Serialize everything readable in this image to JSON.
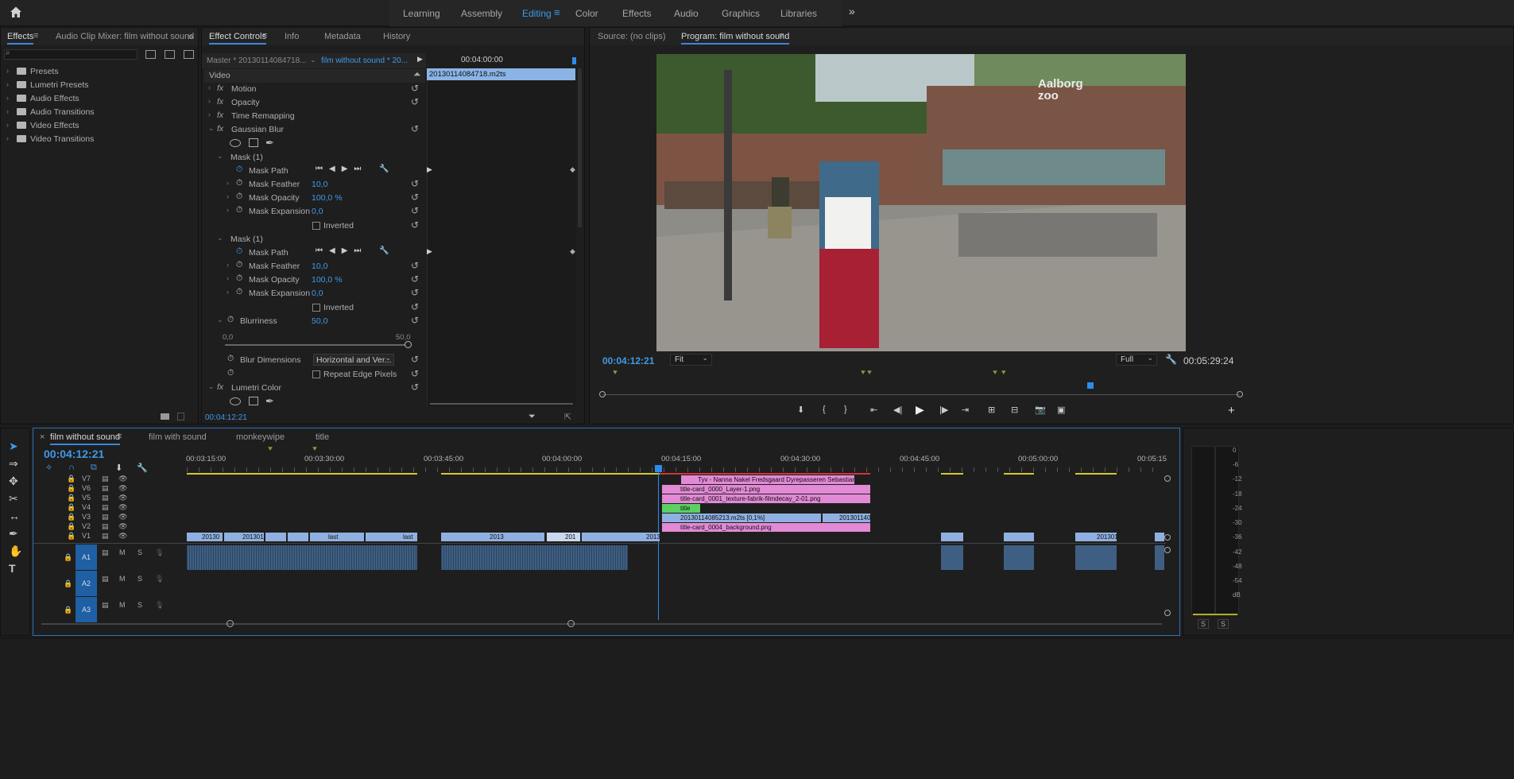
{
  "workspaces": {
    "tabs": [
      "Learning",
      "Assembly",
      "Editing",
      "Color",
      "Effects",
      "Audio",
      "Graphics",
      "Libraries"
    ],
    "active": "Editing"
  },
  "effects_panel": {
    "tabs": [
      "Effects",
      "Audio Clip Mixer: film without sound"
    ],
    "folders": [
      "Presets",
      "Lumetri Presets",
      "Audio Effects",
      "Audio Transitions",
      "Video Effects",
      "Video Transitions"
    ]
  },
  "effect_controls": {
    "tabs": [
      "Effect Controls",
      "Info",
      "Metadata",
      "History"
    ],
    "master": "Master * 20130114084718...",
    "sequence": "film without sound * 20...",
    "timecode_head": "00:04:00:00",
    "clip_name": "20130114084718.m2ts",
    "section_video": "Video",
    "effects": [
      "Motion",
      "Opacity",
      "Time Remapping",
      "Gaussian Blur"
    ],
    "mask1": {
      "title": "Mask (1)",
      "path_label": "Mask Path",
      "feather_label": "Mask Feather",
      "feather": "10,0",
      "opacity_label": "Mask Opacity",
      "opacity": "100,0 %",
      "expansion_label": "Mask Expansion",
      "expansion": "0,0",
      "inverted": "Inverted"
    },
    "mask2": {
      "title": "Mask (1)",
      "path_label": "Mask Path",
      "feather_label": "Mask Feather",
      "feather": "10,0",
      "opacity_label": "Mask Opacity",
      "opacity": "100,0 %",
      "expansion_label": "Mask Expansion",
      "expansion": "0,0",
      "inverted": "Inverted"
    },
    "blurriness_label": "Blurriness",
    "blurriness": "50,0",
    "slider_min": "0,0",
    "slider_max": "50,0",
    "blur_dimensions_label": "Blur Dimensions",
    "blur_dimensions": "Horizontal and Ver...",
    "repeat_edge": "Repeat Edge Pixels",
    "lumetri": "Lumetri Color",
    "footer_timecode": "00:04:12:21"
  },
  "monitor": {
    "source_tab": "Source: (no clips)",
    "program_tab": "Program: film without sound",
    "timecode": "00:04:12:21",
    "fit": "Fit",
    "quality": "Full",
    "duration": "00:05:29:24",
    "sign_text": "Aalborg zoo"
  },
  "timeline": {
    "tabs": [
      "film without sound",
      "film with sound",
      "monkeywipe",
      "title"
    ],
    "timecode": "00:04:12:21",
    "ruler": [
      "00:03:15:00",
      "00:03:30:00",
      "00:03:45:00",
      "00:04:00:00",
      "00:04:15:00",
      "00:04:30:00",
      "00:04:45:00",
      "00:05:00:00",
      "00:05:15"
    ],
    "video_tracks": [
      "V7",
      "V6",
      "V5",
      "V4",
      "V3",
      "V2",
      "V1"
    ],
    "audio_tracks": [
      "A1",
      "A2",
      "A3"
    ],
    "clips": {
      "v7": "Tyv - Nanna Nakel Fredsgaard Dyrepasseren Sebastian - D",
      "v6": "title-card_0000_Layer-1.png",
      "v5": "title-card_0001_texture-fabrik-filmdecay_2-01.png",
      "v4": "title",
      "v3a": "20130114085213.m2ts [0,1%]",
      "v3b": "201301140",
      "v2": "title-card_0004_background.png",
      "v1": [
        "20130",
        "201301",
        "last",
        "last",
        "2013",
        "201",
        "2013",
        "201301"
      ]
    }
  },
  "meter": {
    "labels": [
      "0",
      "-6",
      "-12",
      "-18",
      "-24",
      "-30",
      "-36",
      "-42",
      "-48",
      "-54",
      "dB"
    ],
    "solo": [
      "S",
      "S"
    ]
  },
  "colors": {
    "accent": "#3f9ae8",
    "clip_blue": "#8fb0e0",
    "clip_pink": "#e28ad6",
    "clip_green": "#5bd163"
  }
}
